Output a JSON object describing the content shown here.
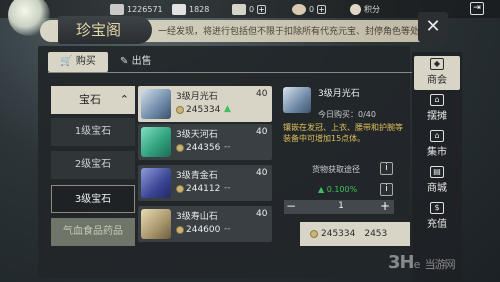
{
  "topbar": {
    "resources": [
      {
        "value": "1226571",
        "icon": "silver-ingot-icon"
      },
      {
        "value": "1828",
        "icon": "scroll-icon"
      },
      {
        "value": "0",
        "icon": "jade-icon"
      },
      {
        "value": "0",
        "icon": "coin-purse-icon"
      },
      {
        "value": "积分",
        "icon": "points-icon"
      }
    ]
  },
  "header": {
    "title": "珍宝阁",
    "description": "一经发现，将进行包括但不限于扣除所有代充元宝、封停角色等处罚",
    "close_label": "✕"
  },
  "tabs": {
    "buy": "购买",
    "sell": "出售"
  },
  "categories": {
    "head": "宝石",
    "items": [
      "1级宝石",
      "2级宝石",
      "3级宝石"
    ],
    "other": "气血食品药品"
  },
  "items": [
    {
      "name": "3级月光石",
      "count": "40",
      "price": "245334",
      "trend": "▲",
      "trend_type": "up",
      "gem_color": "#8ea6c2"
    },
    {
      "name": "3级天河石",
      "count": "40",
      "price": "244356",
      "trend": "--",
      "trend_type": "flat",
      "gem_color": "#3fae8c"
    },
    {
      "name": "3级青金石",
      "count": "40",
      "price": "244112",
      "trend": "--",
      "trend_type": "flat",
      "gem_color": "#3d4a9a"
    },
    {
      "name": "3级寿山石",
      "count": "40",
      "price": "244600",
      "trend": "--",
      "trend_type": "flat",
      "gem_color": "#b9a77a"
    }
  ],
  "detail": {
    "name": "3级月光石",
    "bought": "今日购买：0/40",
    "description": "镶嵌在发冠、上衣、腰带和护腕等装备中可增加15点体。",
    "source_label": "货物获取途径",
    "percent": "▲ 0.100%",
    "quantity": "1",
    "total_price": "245334",
    "total_price_2": "2453"
  },
  "side_nav": [
    {
      "label": "商会",
      "icon": "shop-icon"
    },
    {
      "label": "摆摊",
      "icon": "stall-icon"
    },
    {
      "label": "集市",
      "icon": "market-icon"
    },
    {
      "label": "商城",
      "icon": "mall-icon"
    },
    {
      "label": "充值",
      "icon": "recharge-icon"
    }
  ],
  "watermark": {
    "brand": "3H",
    "suffix": "e",
    "site": "当游网"
  }
}
